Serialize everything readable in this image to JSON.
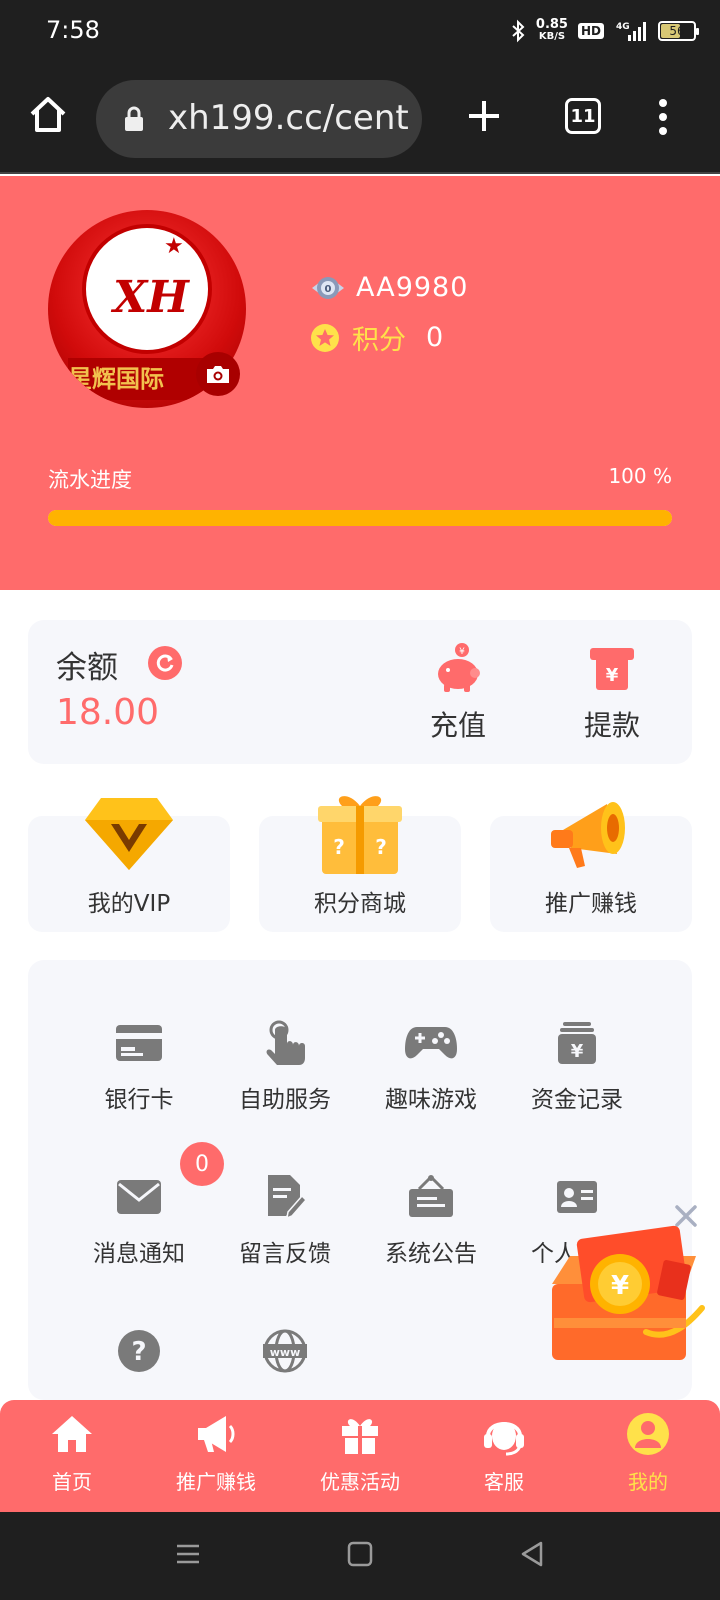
{
  "status_bar": {
    "time": "7:58",
    "net_speed": "0.85",
    "net_unit": "KB/S",
    "hd": "HD",
    "signal": "4G",
    "battery": "56"
  },
  "browser": {
    "url": "xh199.cc/cent",
    "tab_count": "11"
  },
  "profile": {
    "avatar_text": "XH",
    "avatar_ribbon": "星辉国际",
    "username": "AA9980",
    "points_label": "积分",
    "points_value": "0",
    "progress_label": "流水进度",
    "progress_value": "100 %",
    "progress_fraction": 1.0
  },
  "balance": {
    "label": "余额",
    "value": "18.00",
    "recharge_label": "充值",
    "withdraw_label": "提款"
  },
  "features": [
    {
      "label": "我的VIP",
      "icon": "diamond-vip-icon"
    },
    {
      "label": "积分商城",
      "icon": "gift-box-icon"
    },
    {
      "label": "推广赚钱",
      "icon": "megaphone-icon"
    }
  ],
  "menu": [
    {
      "label": "银行卡",
      "icon": "bank-card-icon"
    },
    {
      "label": "自助服务",
      "icon": "hand-pointer-icon"
    },
    {
      "label": "趣味游戏",
      "icon": "gamepad-icon"
    },
    {
      "label": "资金记录",
      "icon": "money-record-icon"
    },
    {
      "label": "消息通知",
      "icon": "envelope-icon"
    },
    {
      "label": "留言反馈",
      "icon": "feedback-icon"
    },
    {
      "label": "系统公告",
      "icon": "notice-board-icon"
    },
    {
      "label": "个人资料",
      "icon": "id-card-icon"
    },
    {
      "label": "",
      "icon": "question-icon"
    },
    {
      "label": "",
      "icon": "www-icon"
    }
  ],
  "message_badge": "0",
  "bottom_nav": [
    {
      "label": "首页",
      "icon": "home-icon"
    },
    {
      "label": "推广赚钱",
      "icon": "megaphone-icon"
    },
    {
      "label": "优惠活动",
      "icon": "gift-icon"
    },
    {
      "label": "客服",
      "icon": "headset-icon"
    },
    {
      "label": "我的",
      "icon": "user-icon"
    }
  ],
  "colors": {
    "brand": "#ff6b6b",
    "accent": "#ffe14a",
    "progress": "#ffb300",
    "card_bg": "#f6f7fb",
    "icon_gray": "#7a7a7a"
  }
}
